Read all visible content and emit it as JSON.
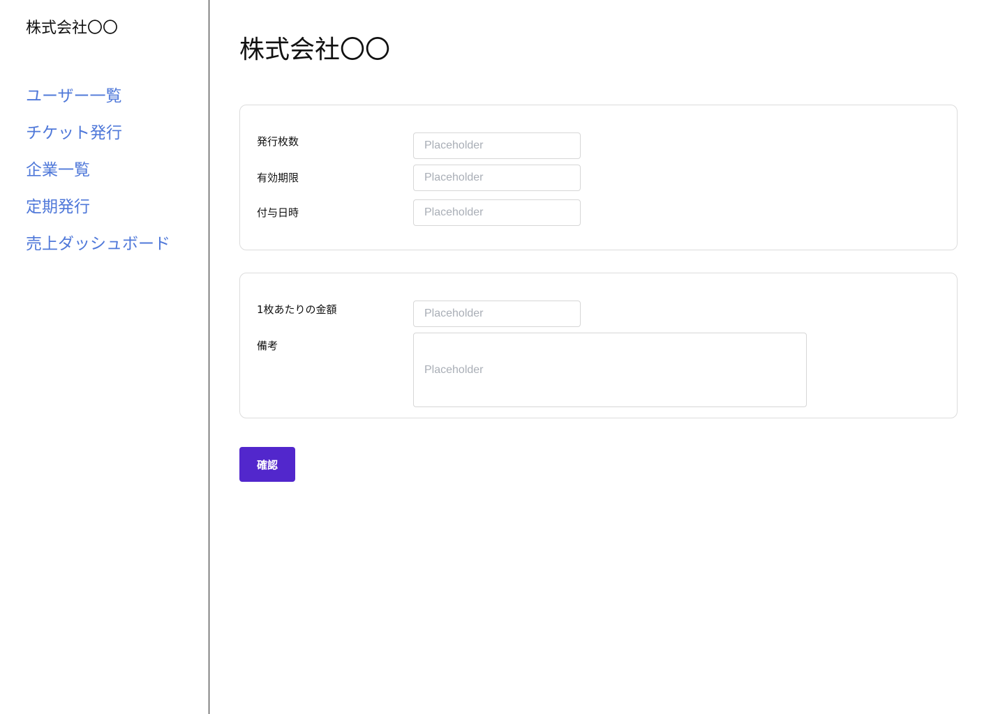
{
  "sidebar": {
    "brand": "株式会社〇〇",
    "items": [
      {
        "label": "ユーザー一覧"
      },
      {
        "label": "チケット発行"
      },
      {
        "label": "企業一覧"
      },
      {
        "label": "定期発行"
      },
      {
        "label": "売上ダッシュボード"
      }
    ]
  },
  "main": {
    "title": "株式会社〇〇",
    "section1": {
      "fields": [
        {
          "label": "発行枚数",
          "value": "",
          "placeholder": "Placeholder"
        },
        {
          "label": "有効期限",
          "value": "",
          "placeholder": "Placeholder"
        },
        {
          "label": "付与日時",
          "value": "",
          "placeholder": "Placeholder"
        }
      ]
    },
    "section2": {
      "price": {
        "label": "1枚あたりの金額",
        "value": "",
        "placeholder": "Placeholder"
      },
      "notes": {
        "label": "備考",
        "value": "",
        "placeholder": "Placeholder"
      }
    },
    "confirm_label": "確認"
  },
  "colors": {
    "nav_link": "#4f78d9",
    "primary_button": "#5227cc",
    "card_border": "#dcdcdc",
    "sidebar_divider": "#222222"
  }
}
